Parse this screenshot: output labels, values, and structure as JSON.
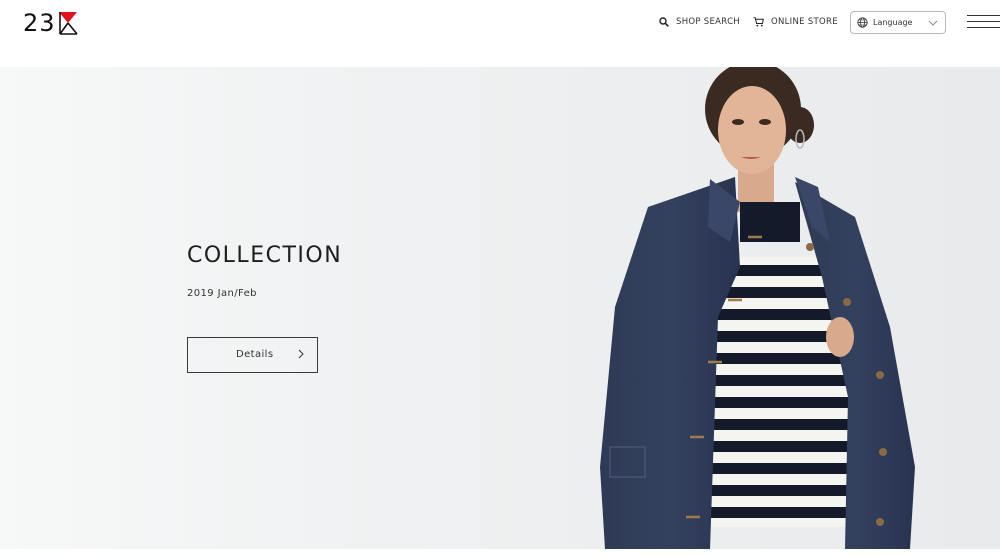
{
  "brand": {
    "logo_text": "23",
    "mark_color": "#e3101d"
  },
  "nav": {
    "shop_search": "SHOP SEARCH",
    "online_store": "ONLINE STORE",
    "language_label": "Language"
  },
  "hero": {
    "title": "COLLECTION",
    "subtitle": "2019 Jan/Feb",
    "button_label": "Details"
  },
  "icons": {
    "search": "search-icon",
    "cart": "cart-icon",
    "globe": "globe-icon",
    "chevron": "chevron-down-icon",
    "menu": "hamburger-menu-icon",
    "arrow": "chevron-right-icon"
  },
  "colors": {
    "background": "#ffffff",
    "hero_bg": "#eef0f1",
    "text": "#222222",
    "accent_red": "#e3101d"
  }
}
